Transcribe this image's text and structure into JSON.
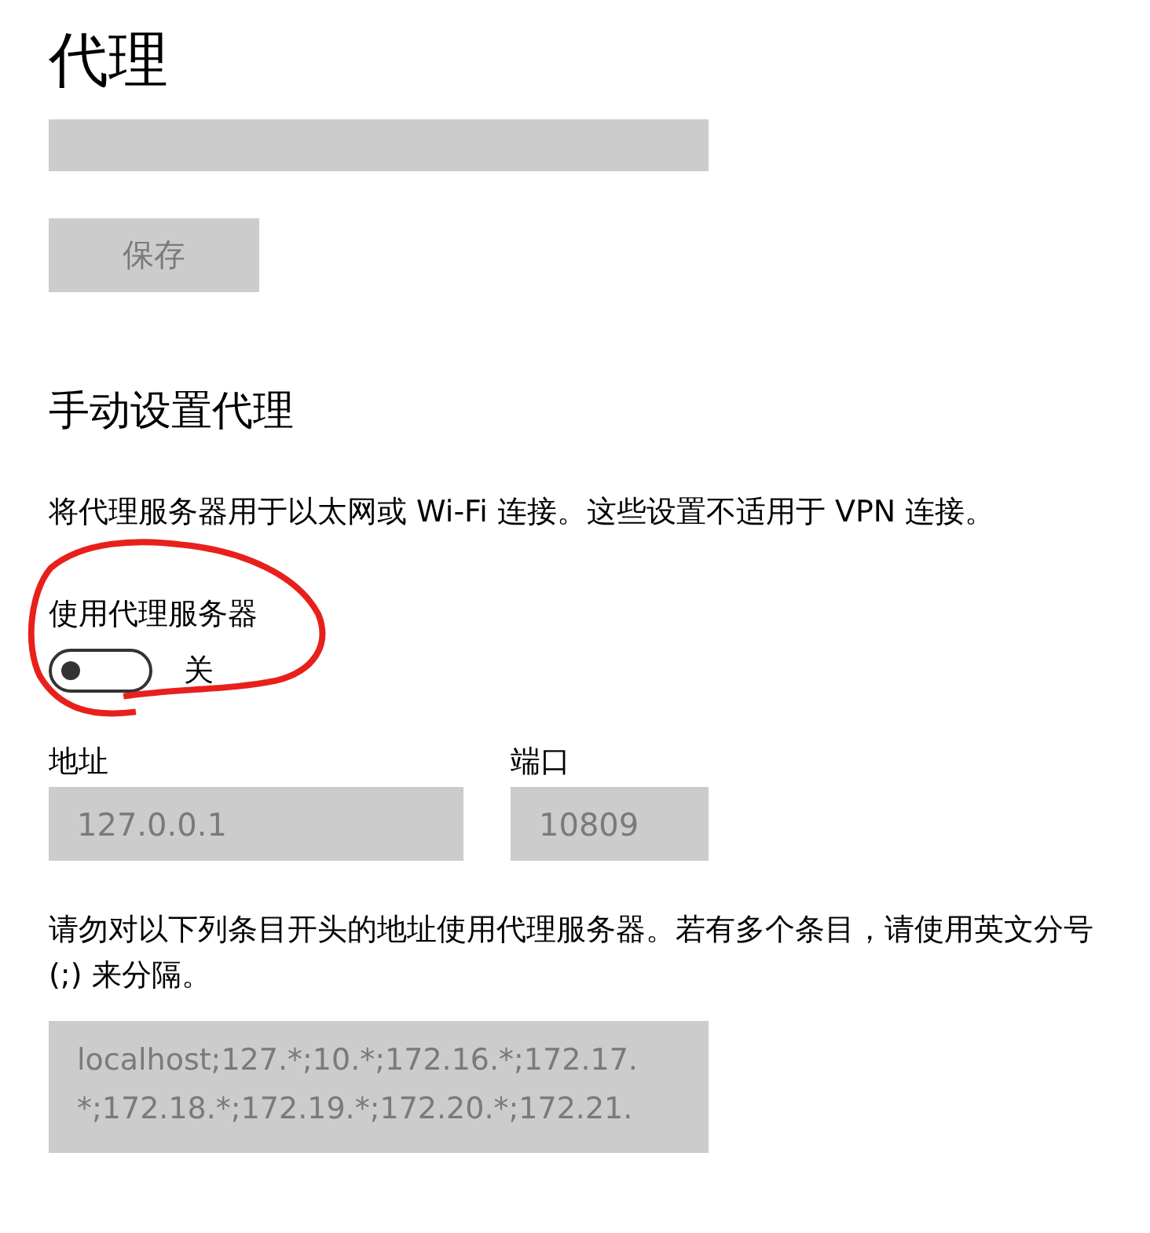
{
  "title": "代理",
  "script_field": {
    "disabled": true
  },
  "save_button": {
    "label": "保存",
    "disabled": true
  },
  "section_title": "手动设置代理",
  "description": "将代理服务器用于以太网或 Wi-Fi 连接。这些设置不适用于 VPN 连接。",
  "proxy_toggle": {
    "label": "使用代理服务器",
    "on": false,
    "state_text": "关"
  },
  "address": {
    "label": "地址",
    "value": "127.0.0.1",
    "disabled": true
  },
  "port": {
    "label": "端口",
    "value": "10809",
    "disabled": true
  },
  "exceptions_text": "请勿对以下列条目开头的地址使用代理服务器。若有多个条目，请使用英文分号 (;) 来分隔。",
  "exceptions": {
    "lines": [
      "localhost;127.*;10.*;172.16.*;172.17.",
      "*;172.18.*;172.19.*;172.20.*;172.21."
    ],
    "disabled": true
  },
  "annotation": {
    "kind": "freehand-circle"
  }
}
